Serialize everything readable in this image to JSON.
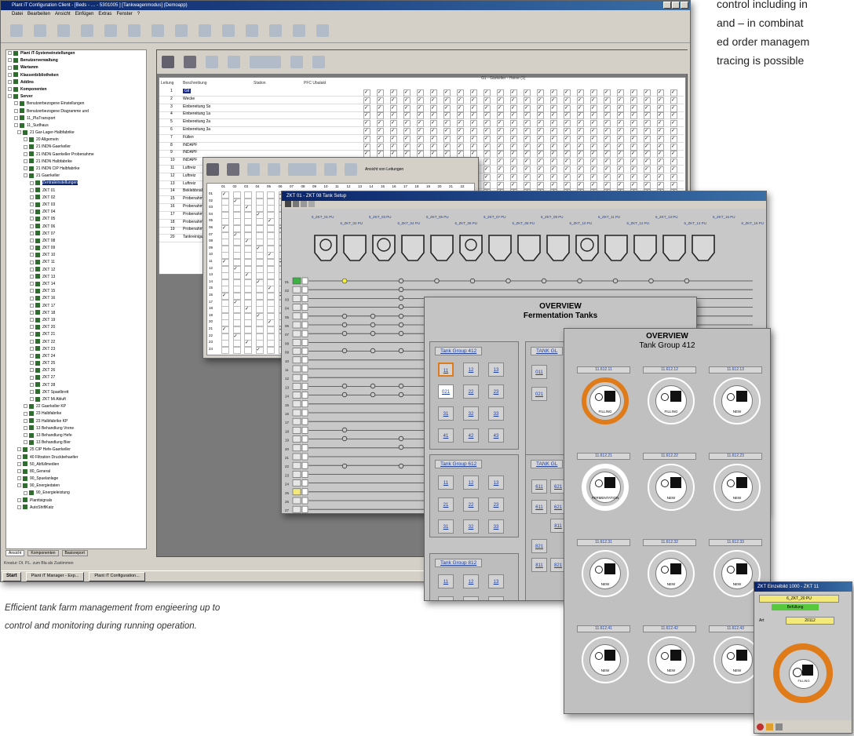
{
  "main_window": {
    "title": "Plant iT Configuration Client - [Beds - … - 5301005 ] [Tankwagenmodus] (Demoapp)",
    "menu": [
      "Datei",
      "Bearbeiten",
      "Ansicht",
      "Einfügen",
      "Extras",
      "Fenster",
      "?"
    ],
    "tree_items": [
      "Plant iT-Systemeinstellungen",
      "Benutzerverwaltung",
      "Wartamm",
      "Klassenbibliotheken",
      "Addins",
      "Komponenten",
      "Server",
      "Benutzerbezogene Einstellungen",
      "Benutzerbezogene Diagramme und",
      "11_PlaTransport",
      "11_Sudhaus",
      "21 Gar-Lager-Halbfabrike",
      "20 Allgemein",
      "21 INDN-Gaerkeller",
      "21 INDN Gaerkeller Probenahme",
      "21 INDN Halbfabrike",
      "21 INDN CIP Halbfabrike",
      "21 Gaerkeller",
      "Zentraleinstellungen",
      "ZKT 01",
      "ZKT 02",
      "ZKT 03",
      "ZKT 04",
      "ZKT 05",
      "ZKT 06",
      "ZKT 07",
      "ZKT 08",
      "ZKT 09",
      "ZKT 10",
      "ZKT 11",
      "ZKT 12",
      "ZKT 13",
      "ZKT 14",
      "ZKT 15",
      "ZKT 16",
      "ZKT 17",
      "ZKT 18",
      "ZKT 19",
      "ZKT 20",
      "ZKT 21",
      "ZKT 22",
      "ZKT 23",
      "ZKT 24",
      "ZKT 25",
      "ZKT 26",
      "ZKT 27",
      "ZKT 28",
      "ZKT Spaelbrett",
      "ZKT Mi Abluft",
      "22 Gaerkeller KP",
      "23 Halbfabrike",
      "23 Halbfabrike KP",
      "13 Behandlung Vrene",
      "13 Behandlung Hefe",
      "13 Behandlung Bier",
      "25 CIP Hefe-Gaerkeller",
      "40 Filtration Druckbehaelter",
      "50_Abfüllmedien",
      "80_General",
      "90_Spuelanlage",
      "90_Energiedaten",
      "90_Energieleistung",
      "Planttsignals",
      "AutoShiftKatz"
    ],
    "status_text": "Kreatur: Dt. P.L. zum Bla als Zustimmen",
    "tree_tabs": [
      "Ansicht",
      "Komponenten",
      "Basisreport"
    ]
  },
  "grid_back": {
    "headers": [
      "Leitung",
      "Beschreibung",
      "Station",
      "PFC Ubalakt"
    ],
    "group_header": "G1 - Gärkeller - Heine (1)",
    "rows": [
      "Gil",
      "Wecke",
      "Einbereitung Ss",
      "Einbereitung 1a",
      "Einbereitung 2a",
      "Einbereitung 3a",
      "Füllen",
      "INDAPF",
      "INDAPF",
      "INDAPF",
      "Luftreiz",
      "Luftreiz",
      "Luftreiz",
      "Beklebbnaltung",
      "Probenahme",
      "Probenahme",
      "Probenahme",
      "Probenahme",
      "Probenahme",
      "Tankreinigung"
    ]
  },
  "grid_mid": {
    "col_numbers": [
      "01",
      "02",
      "03",
      "04",
      "05",
      "06",
      "07",
      "08",
      "09",
      "10",
      "11",
      "12",
      "13",
      "14",
      "15",
      "16",
      "17",
      "18",
      "19",
      "20",
      "21",
      "22"
    ],
    "label": "Ansicht von Leitungen"
  },
  "tank_panel": {
    "title": "ZKT 01 - ZKT 08 Tank Setup",
    "tank_labels": [
      "6_ZKT_01 PU",
      "6_ZKT_02 PU",
      "6_ZKT_03 PU",
      "6_ZKT_04 PU",
      "6_ZKT_05 PU",
      "6_ZKT_06 PU",
      "6_ZKT_07 PU",
      "6_ZKT_08 PU",
      "6_ZKT_09 PU",
      "6_ZKT_10 PU",
      "6_ZKT_11 PU",
      "6_ZKT_12 PU",
      "6_ZKT_13 PU",
      "6_ZKT_14 PU",
      "6_ZKT_15 PU",
      "6_ZKT_16 PU"
    ],
    "row_numbers": [
      "01",
      "02",
      "03",
      "04",
      "05",
      "06",
      "07",
      "08",
      "09",
      "10",
      "11",
      "12",
      "13",
      "14",
      "15",
      "16",
      "17",
      "18",
      "19",
      "20",
      "21",
      "22",
      "23",
      "24",
      "25",
      "26",
      "27"
    ]
  },
  "overview_fermentation": {
    "title": "OVERVIEW",
    "subtitle": "Fermentation Tanks",
    "groups": [
      {
        "name": "Tank Group 412",
        "tanks": [
          "11",
          "12",
          "13",
          "021",
          "22",
          "23",
          "31",
          "32",
          "33",
          "41",
          "42",
          "43"
        ]
      },
      {
        "name": "Tank Group 612",
        "tanks": [
          "11",
          "12",
          "13",
          "21",
          "22",
          "23",
          "31",
          "32",
          "33"
        ]
      },
      {
        "name": "Tank Group 812",
        "tanks": [
          "11",
          "12",
          "13",
          "21",
          "22",
          "23"
        ]
      }
    ],
    "partial_groups": [
      "TANK GL",
      "TANK GL"
    ],
    "partial_tanks": [
      "011",
      "021",
      "611",
      "621",
      "611",
      "621",
      "811",
      "821",
      "811",
      "821"
    ]
  },
  "overview_group": {
    "title": "OVERVIEW",
    "subtitle": "Tank Group 412",
    "tanks": [
      {
        "id": "11.612.11",
        "state": "FILLING"
      },
      {
        "id": "11.612.12",
        "state": "FILLING"
      },
      {
        "id": "11.612.13",
        "state": "NEW"
      },
      {
        "id": "11.612.21",
        "state": "FERMENTATION"
      },
      {
        "id": "11.612.22",
        "state": "NEW"
      },
      {
        "id": "11.612.23",
        "state": "NEW"
      },
      {
        "id": "11.612.31",
        "state": "NEW"
      },
      {
        "id": "11.612.32",
        "state": "NEW"
      },
      {
        "id": "11.612.33",
        "state": "NEW"
      },
      {
        "id": "11.612.41",
        "state": "NEW"
      },
      {
        "id": "11.612.42",
        "state": "NEW"
      },
      {
        "id": "11.612.43",
        "state": "NEW"
      }
    ]
  },
  "detail_window": {
    "title": "ZKT Einzelbild 1000 - ZKT 11",
    "tank_label": "6_ZKT_20 PU",
    "status": "Befüllung",
    "field_label": "Art",
    "field_value": "20112",
    "state": "FILLING"
  },
  "taskbar": {
    "start": "Start",
    "items": [
      "Plant iT Manager - Exp...",
      "Plant iT Configuration..."
    ]
  },
  "caption": {
    "line1": "Efficient tank farm management from engieering up to",
    "line2": "control and monitoring during running operation."
  },
  "side_text": {
    "lines": [
      "control including in",
      "and – in combinat",
      "ed order managem",
      "tracing is possible"
    ]
  },
  "colors": {
    "accent_orange": "#e07b1a",
    "title_blue": "#0a246a",
    "panel_grey": "#c8c8c8",
    "tank_blue": "#1f3fa0"
  }
}
